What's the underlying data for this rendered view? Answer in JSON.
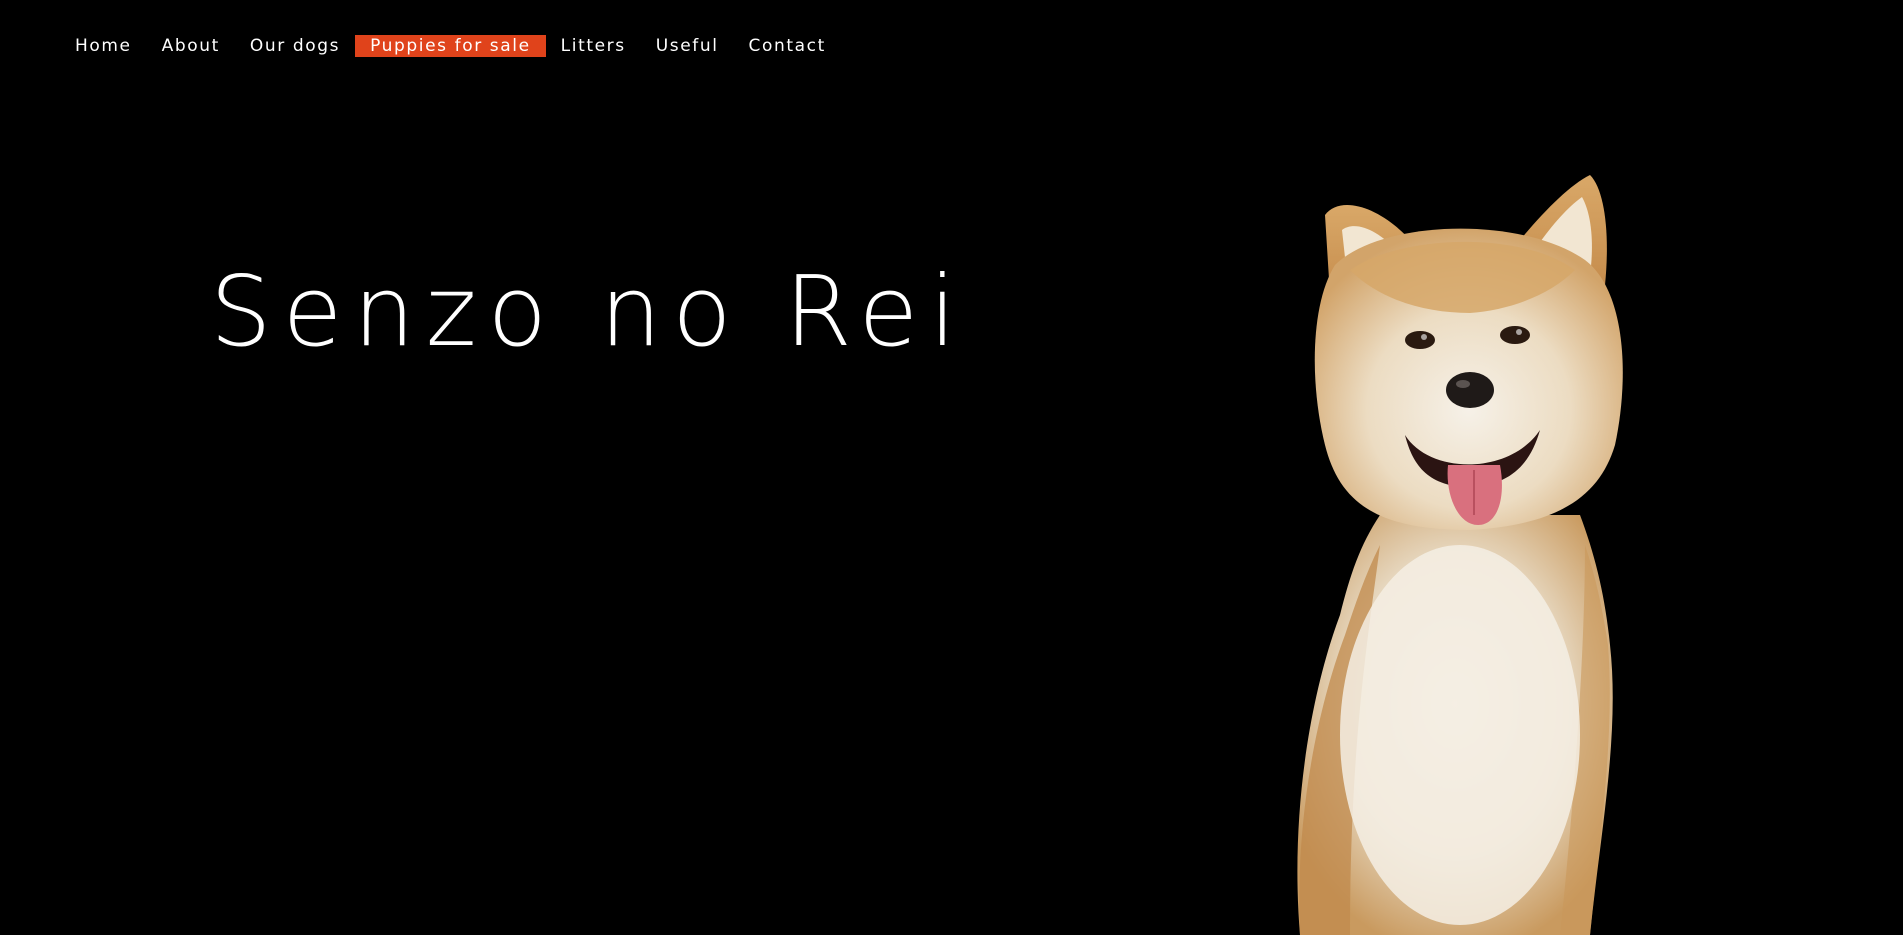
{
  "nav": {
    "items": [
      {
        "label": "Home",
        "active": false
      },
      {
        "label": "About",
        "active": false
      },
      {
        "label": "Our dogs",
        "active": false
      },
      {
        "label": "Puppies for sale",
        "active": true
      },
      {
        "label": "Litters",
        "active": false
      },
      {
        "label": "Useful",
        "active": false
      },
      {
        "label": "Contact",
        "active": false
      }
    ]
  },
  "hero": {
    "title": "Senzo no Rei"
  },
  "colors": {
    "background": "#000000",
    "accent": "#e0431b",
    "text": "#ffffff"
  },
  "image": {
    "subject": "akita-dog-photo"
  }
}
